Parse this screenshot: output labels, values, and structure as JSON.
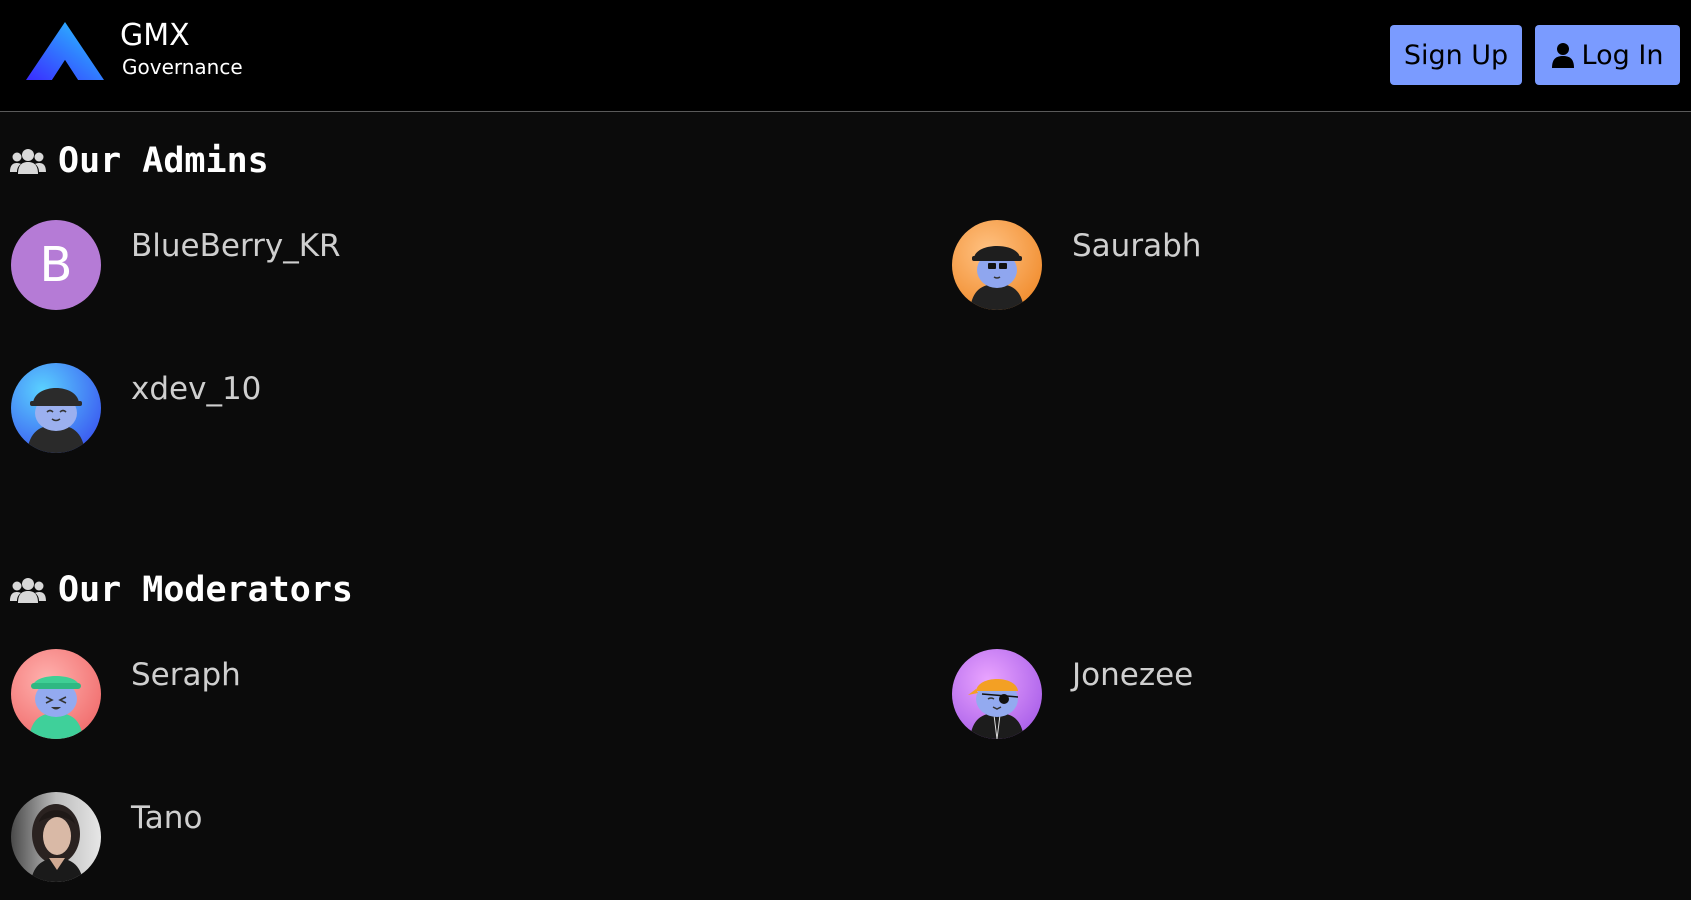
{
  "header": {
    "brand_title": "GMX",
    "brand_subtitle": "Governance",
    "signup_label": "Sign Up",
    "login_label": "Log In",
    "button_color": "#7a9bff"
  },
  "admins": {
    "heading": "Our Admins",
    "members": [
      {
        "name": "BlueBerry_KR",
        "avatar": "letter-avatar",
        "initial": "B",
        "color": "#b57bd6"
      },
      {
        "name": "Saurabh",
        "avatar": "character-avatar-orange"
      },
      {
        "name": "xdev_10",
        "avatar": "character-avatar-blue"
      }
    ]
  },
  "moderators": {
    "heading": "Our Moderators",
    "members": [
      {
        "name": "Seraph",
        "avatar": "character-avatar-pink"
      },
      {
        "name": "Jonezee",
        "avatar": "character-avatar-purple"
      },
      {
        "name": "Tano",
        "avatar": "photo-avatar"
      }
    ]
  }
}
